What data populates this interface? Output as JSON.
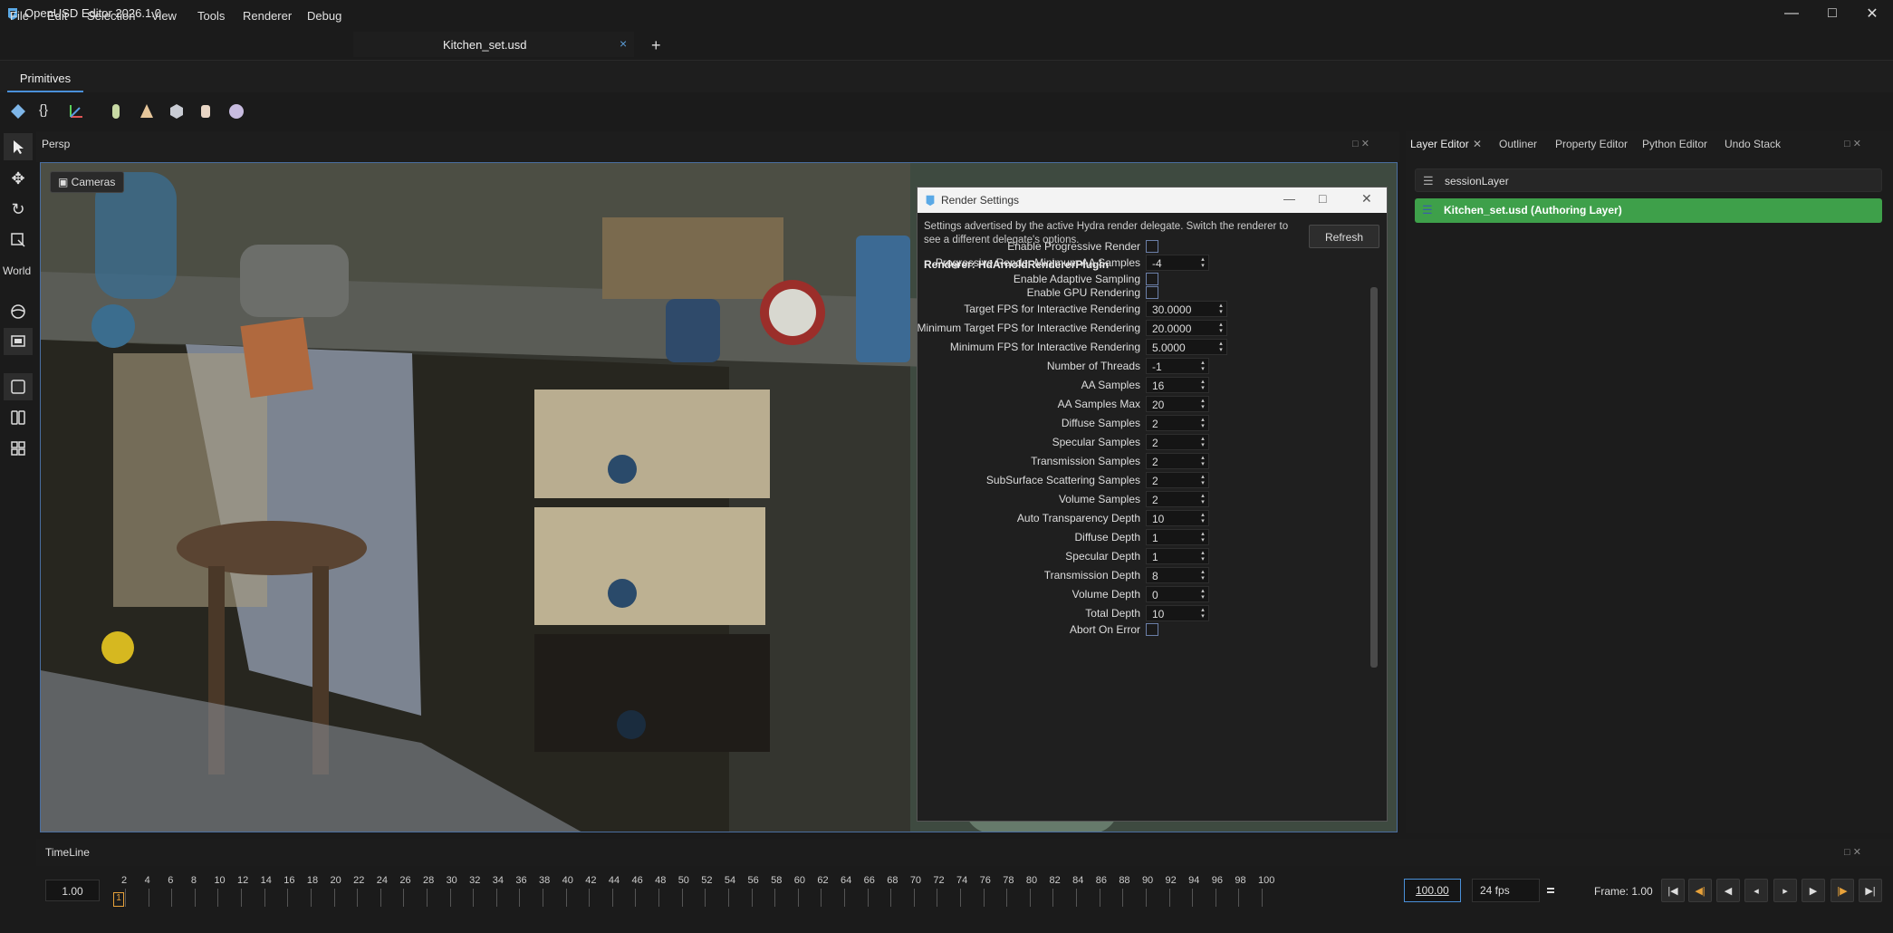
{
  "app": {
    "title": "OpenUSD Editor 2026.1.0"
  },
  "menu": [
    "File",
    "Edit",
    "Selection",
    "View",
    "Tools",
    "Renderer",
    "Debug"
  ],
  "document_tab": {
    "label": "Kitchen_set.usd",
    "close": "×",
    "new_tab": "+"
  },
  "primitives_tab": "Primitives",
  "toolbar_icons": [
    "mesh-icon",
    "scope-icon",
    "xform-icon",
    "capsule-icon",
    "cone-icon",
    "cube-icon",
    "cylinder-icon",
    "sphere-icon"
  ],
  "left_tools": {
    "world_label": "World"
  },
  "viewport": {
    "tab": "Persp",
    "cameras_button": "Cameras"
  },
  "right_panel": {
    "tabs": [
      "Layer Editor",
      "Outliner",
      "Property Editor",
      "Python Editor",
      "Undo Stack"
    ],
    "layers": [
      {
        "name": "sessionLayer"
      },
      {
        "name": "Kitchen_set.usd  (Authoring Layer)"
      }
    ]
  },
  "render_settings": {
    "title": "Render Settings",
    "description": "Settings advertised by the active Hydra render delegate. Switch the renderer to see a different delegate's options.",
    "refresh": "Refresh",
    "renderer": "Renderer: HdArnoldRendererPlugin",
    "rows": [
      {
        "label": "Enable Progressive Render",
        "kind": "check",
        "value": ""
      },
      {
        "label": "Progressive Render Minimum AA Samples",
        "kind": "int",
        "value": "-4"
      },
      {
        "label": "Enable Adaptive Sampling",
        "kind": "check",
        "value": ""
      },
      {
        "label": "Enable GPU Rendering",
        "kind": "check",
        "value": ""
      },
      {
        "label": "Target FPS for Interactive Rendering",
        "kind": "float",
        "value": "30.0000"
      },
      {
        "label": "Minimum Target FPS for Interactive Rendering",
        "kind": "float",
        "value": "20.0000"
      },
      {
        "label": "Minimum FPS for Interactive Rendering",
        "kind": "float",
        "value": "5.0000"
      },
      {
        "label": "Number of Threads",
        "kind": "int",
        "value": "-1"
      },
      {
        "label": "AA Samples",
        "kind": "int",
        "value": "16"
      },
      {
        "label": "AA Samples Max",
        "kind": "int",
        "value": "20"
      },
      {
        "label": "Diffuse Samples",
        "kind": "int",
        "value": "2"
      },
      {
        "label": "Specular Samples",
        "kind": "int",
        "value": "2"
      },
      {
        "label": "Transmission Samples",
        "kind": "int",
        "value": "2"
      },
      {
        "label": "SubSurface Scattering Samples",
        "kind": "int",
        "value": "2"
      },
      {
        "label": "Volume Samples",
        "kind": "int",
        "value": "2"
      },
      {
        "label": "Auto Transparency Depth",
        "kind": "int",
        "value": "10"
      },
      {
        "label": "Diffuse Depth",
        "kind": "int",
        "value": "1"
      },
      {
        "label": "Specular Depth",
        "kind": "int",
        "value": "1"
      },
      {
        "label": "Transmission Depth",
        "kind": "int",
        "value": "8"
      },
      {
        "label": "Volume Depth",
        "kind": "int",
        "value": "0"
      },
      {
        "label": "Total Depth",
        "kind": "int",
        "value": "10"
      },
      {
        "label": "Abort On Error",
        "kind": "check",
        "value": ""
      }
    ]
  },
  "timeline": {
    "tab": "TimeLine",
    "start": "1.00",
    "end": "100.00",
    "fps": "24 fps",
    "frame": "Frame: 1.00",
    "current_frame": "1",
    "ticks": [
      "2",
      "4",
      "6",
      "8",
      "10",
      "12",
      "14",
      "16",
      "18",
      "20",
      "22",
      "24",
      "26",
      "28",
      "30",
      "32",
      "34",
      "36",
      "38",
      "40",
      "42",
      "44",
      "46",
      "48",
      "50",
      "52",
      "54",
      "56",
      "58",
      "60",
      "62",
      "64",
      "66",
      "68",
      "70",
      "72",
      "74",
      "76",
      "78",
      "80",
      "82",
      "84",
      "86",
      "88",
      "90",
      "92",
      "94",
      "96",
      "98",
      "100"
    ]
  },
  "colors": {
    "accent": "#4a90d9",
    "authoring_layer": "#3ea04a",
    "play_orange": "#e8a23a"
  }
}
